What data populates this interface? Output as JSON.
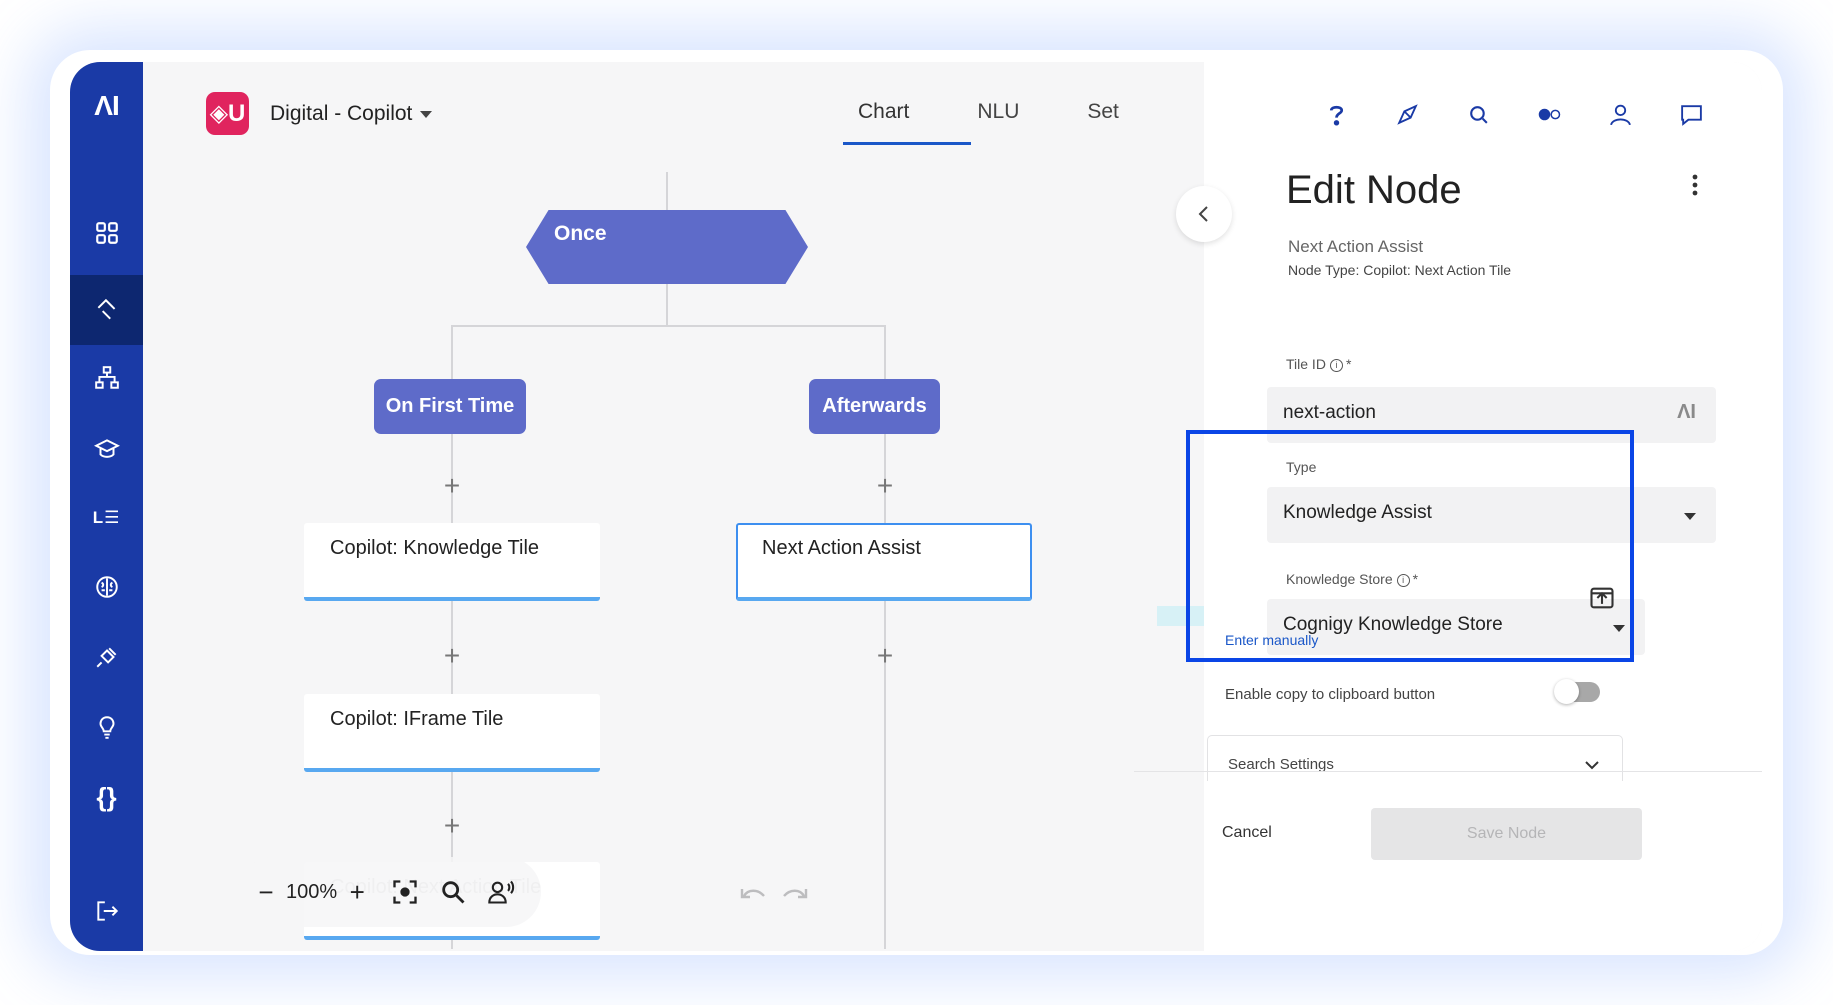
{
  "sidebar": {
    "logo": "ΛI",
    "items": [
      "dashboard",
      "build",
      "flows",
      "training",
      "logs",
      "ai",
      "integrations",
      "insights",
      "code",
      "logout"
    ],
    "list_icon_text": "L☰",
    "code_icon_text": "{}"
  },
  "header": {
    "project_badge": "◈U",
    "project_name": "Digital - Copilot",
    "tabs": [
      "Chart",
      "NLU",
      "Set"
    ]
  },
  "flow": {
    "start_node": "Once",
    "branch_left": "On First Time",
    "branch_right": "Afterwards",
    "nodes": [
      "Copilot: Knowledge Tile",
      "Copilot: IFrame Tile",
      "Copilot: Next Action Tile"
    ],
    "selected_node": "Next Action Assist"
  },
  "zoom": {
    "minus": "−",
    "level": "100%",
    "plus": "+"
  },
  "panel": {
    "title": "Edit Node",
    "node_label": "Next Action Assist",
    "node_type": "Node Type: Copilot: Next Action Tile",
    "tile_id_label": "Tile ID",
    "tile_id_required": "*",
    "tile_id_value": "next-action",
    "tile_id_suffix": "ΛI",
    "type_label": "Type",
    "type_value": "Knowledge Assist",
    "store_label": "Knowledge Store",
    "store_required": "*",
    "store_value": "Cognigy Knowledge Store",
    "enter_manually": "Enter manually",
    "copy_label": "Enable copy to clipboard button",
    "copy_enabled": false,
    "search_settings": "Search Settings",
    "cancel": "Cancel",
    "save": "Save Node"
  },
  "colors": {
    "sidebar": "#1a3aa6",
    "node_fill": "#5e6bc9",
    "accent": "#1a57c8",
    "highlight": "#0a45e6",
    "badge": "#e0245e"
  }
}
